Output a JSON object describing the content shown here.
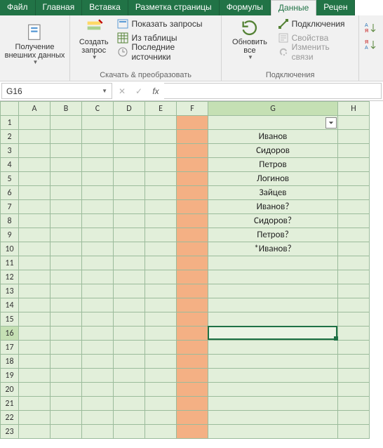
{
  "tabs": {
    "file": "Файл",
    "home": "Главная",
    "insert": "Вставка",
    "layout": "Разметка страницы",
    "formulas": "Формулы",
    "data": "Данные",
    "review": "Рецен"
  },
  "ribbon": {
    "getData": {
      "label": "Получение\nвнешних данных"
    },
    "transform": {
      "newQuery": "Создать\nзапрос",
      "showQueries": "Показать запросы",
      "fromTable": "Из таблицы",
      "recentSources": "Последние источники",
      "title": "Скачать & преобразовать"
    },
    "connections": {
      "refreshAll": "Обновить\nвсе",
      "connections": "Подключения",
      "properties": "Свойства",
      "editLinks": "Изменить связи",
      "title": "Подключения"
    },
    "sort": {
      "az": "A↓Я",
      "za": "Я↓A"
    }
  },
  "nameBox": "G16",
  "columns": [
    "A",
    "B",
    "C",
    "D",
    "E",
    "F",
    "G",
    "H"
  ],
  "rows": [
    1,
    2,
    3,
    4,
    5,
    6,
    7,
    8,
    9,
    10,
    11,
    12,
    13,
    14,
    15,
    16,
    17,
    18,
    19,
    20,
    21,
    22,
    23
  ],
  "gData": {
    "2": "Иванов",
    "3": "Сидоров",
    "4": "Петров",
    "5": "Логинов",
    "6": "Зайцев",
    "7": "Иванов?",
    "8": "Сидоров?",
    "9": "Петров?",
    "10": "*Иванов?"
  },
  "activeCell": {
    "row": 16,
    "col": "G"
  }
}
